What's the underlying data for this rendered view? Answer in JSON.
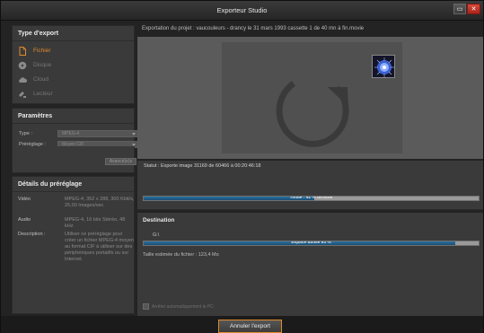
{
  "window": {
    "title": "Exporteur Studio",
    "restore_glyph": "▭",
    "close_glyph": "✕"
  },
  "export_type": {
    "heading": "Type d'export",
    "items": [
      {
        "label": "Fichier",
        "icon": "file-icon",
        "active": true
      },
      {
        "label": "Disque",
        "icon": "disc-icon",
        "active": false
      },
      {
        "label": "Cloud",
        "icon": "cloud-icon",
        "active": false
      },
      {
        "label": "Lecteur",
        "icon": "device-icon",
        "active": false
      }
    ]
  },
  "parameters": {
    "heading": "Paramètres",
    "type_label": "Type :",
    "type_value": "MPEG-4",
    "preset_label": "Préréglage :",
    "preset_value": "Moyen CIF",
    "advanced_label": "Avancé(e)s"
  },
  "preset_details": {
    "heading": "Détails du préréglage",
    "video_label": "Vidéo",
    "video_value": "MPEG-4, 352 x 288, 300 Kbit/s, 25,00 Images/sec",
    "audio_label": "Audio",
    "audio_value": "MPEG-4, 16 bits Stéréo, 48 kHz",
    "description_label": "Description :",
    "description_value": "Utiliser ce préréglage pour créer un fichier MPEG-4 moyen au format CIF à utiliser sur des périphériques portatifs ou sur Internet."
  },
  "project_title": "Exportation du projet : vaucouleurs - drancy le 31 mars 1993 cassette 1 de 40 mn  à fin.movie",
  "status": {
    "text": "Statut : Exporte image 31169 de 60466 à 00:20:46:18",
    "total_label": "Totale : 51 % terminé",
    "total_percent": 51
  },
  "destination": {
    "heading": "Destination",
    "drive": "G:\\",
    "space_label": "Espace utilisé 93 %",
    "space_percent": 93,
    "estimated_size": "Taille estimée du fichier : 123,4 Mo",
    "shutdown_label": "Arrêter automatiquement le PC"
  },
  "footer": {
    "cancel_label": "Annuler l'export"
  },
  "colors": {
    "accent": "#e08a2c",
    "progress": "#2a6f9e"
  }
}
